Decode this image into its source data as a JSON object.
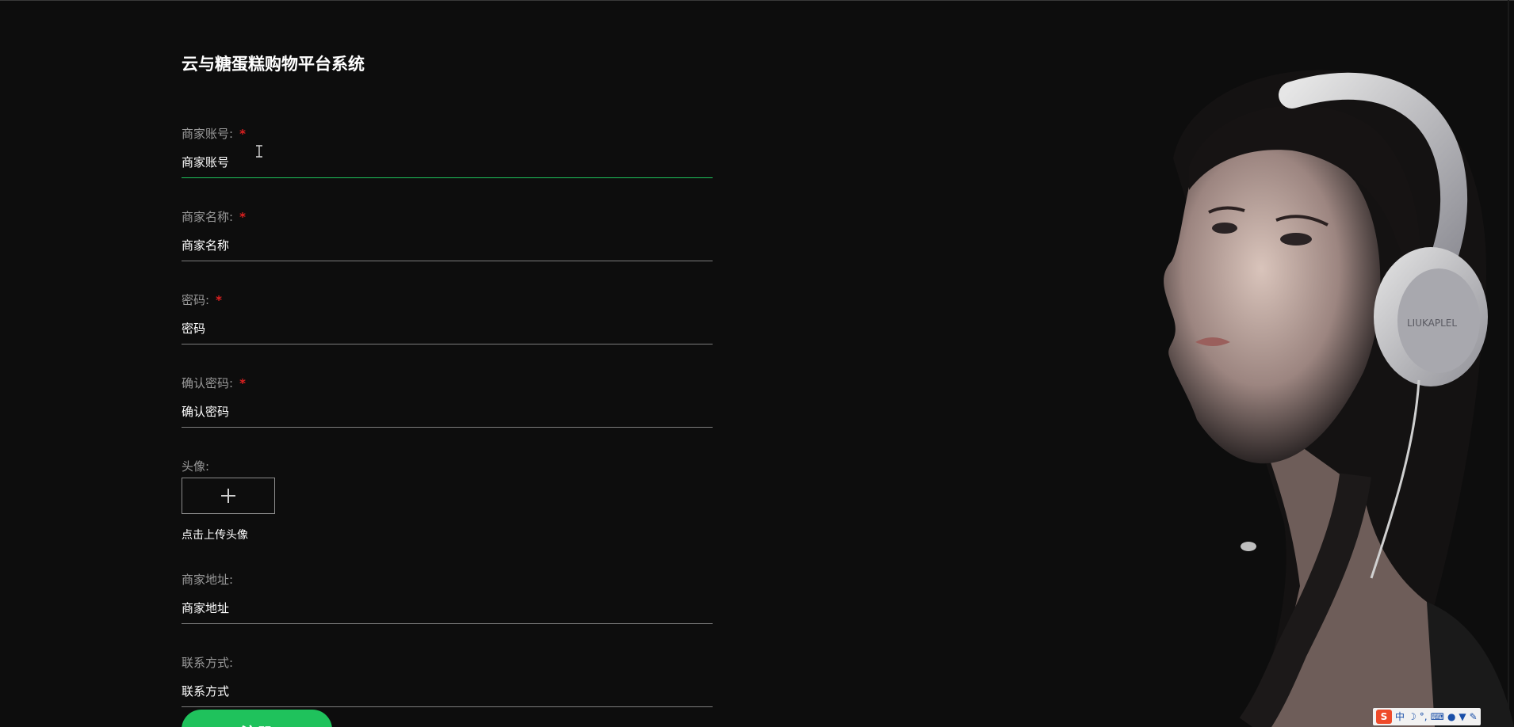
{
  "app": {
    "title": "云与糖蛋糕购物平台系统"
  },
  "form": {
    "fields": [
      {
        "label": "商家账号:",
        "required": true,
        "placeholder": "商家账号",
        "value": ""
      },
      {
        "label": "商家名称:",
        "required": true,
        "placeholder": "商家名称",
        "value": ""
      },
      {
        "label": "密码:",
        "required": true,
        "placeholder": "密码",
        "value": ""
      },
      {
        "label": "确认密码:",
        "required": true,
        "placeholder": "确认密码",
        "value": ""
      }
    ],
    "avatar": {
      "label": "头像:",
      "upload_icon": "plus-icon",
      "hint": "点击上传头像"
    },
    "address": {
      "label": "商家地址:",
      "placeholder": "商家地址",
      "value": ""
    },
    "contact": {
      "label": "联系方式:",
      "placeholder": "联系方式",
      "value": ""
    },
    "required_mark": "*",
    "submit_label": "注册"
  },
  "colors": {
    "accent": "#1fc25c",
    "required": "#e02020",
    "background": "#0d0d0d"
  },
  "tray": {
    "ime_logo": "S",
    "ime_mode": "中"
  }
}
